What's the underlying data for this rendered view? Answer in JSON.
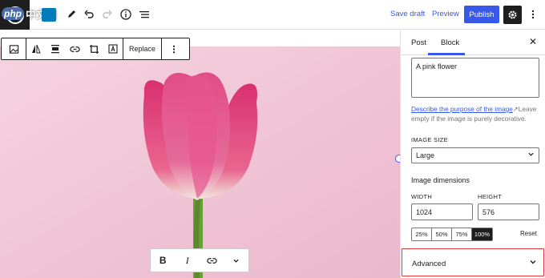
{
  "watermark": {
    "php": "php",
    "cn": "中文网"
  },
  "header": {
    "save_draft": "Save draft",
    "preview": "Preview",
    "publish": "Publish"
  },
  "block_toolbar": {
    "replace": "Replace"
  },
  "format_toolbar": {
    "bold": "B",
    "italic": "I"
  },
  "sidebar": {
    "tabs": [
      "Post",
      "Block"
    ],
    "close": "✕",
    "alt_text_value": "A pink flower",
    "help_link": "Describe the purpose of the image",
    "help_text": "Leave empty if the image is purely decorative.",
    "image_size_label": "IMAGE SIZE",
    "image_size_value": "Large",
    "dimensions_label": "Image dimensions",
    "width_label": "WIDTH",
    "height_label": "HEIGHT",
    "width_value": "1024",
    "height_value": "576",
    "percentages": [
      "25%",
      "50%",
      "75%",
      "100%"
    ],
    "active_percentage": "100%",
    "reset": "Reset",
    "advanced": "Advanced"
  },
  "colors": {
    "accent": "#3858e9",
    "image_bg": "#f3c9d8",
    "highlight": "#e53935"
  }
}
